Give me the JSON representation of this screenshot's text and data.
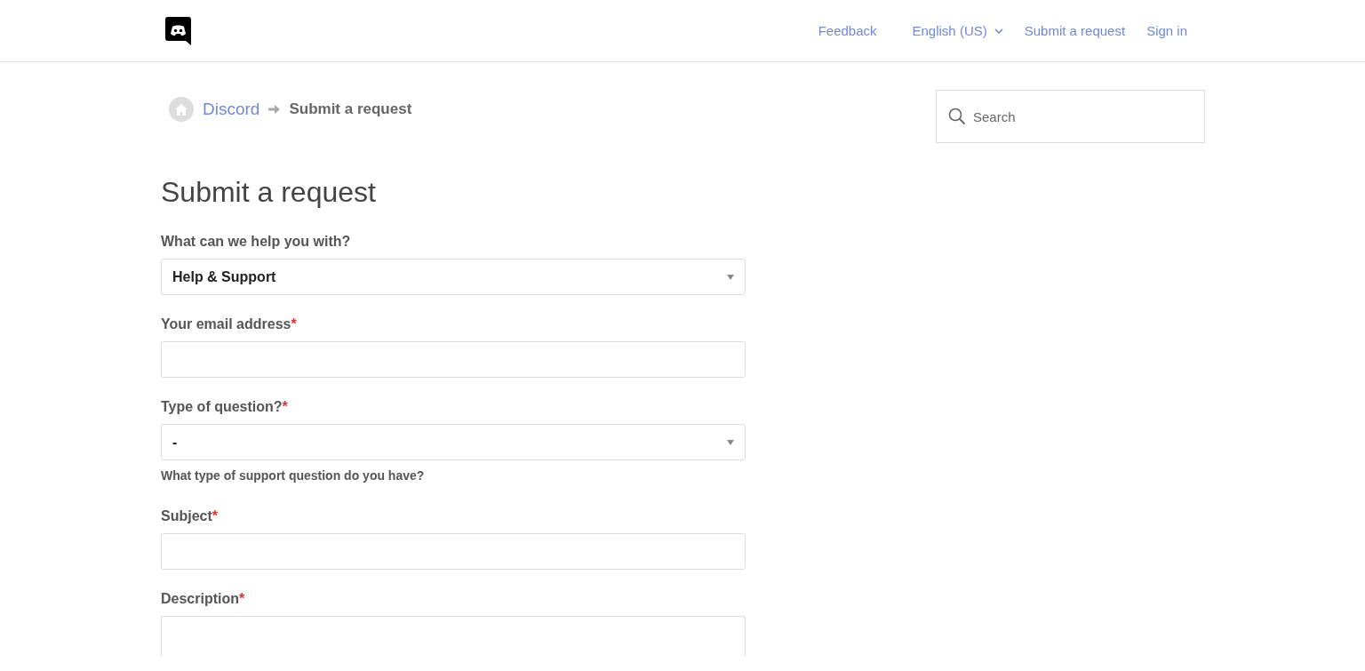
{
  "header": {
    "nav": [
      {
        "kind": "link",
        "label": "Feedback"
      },
      {
        "kind": "dropdown",
        "label": "English (US)"
      },
      {
        "kind": "link",
        "label": "Submit a request"
      },
      {
        "kind": "link",
        "label": "Sign in"
      }
    ]
  },
  "breadcrumb": {
    "items": [
      "Discord"
    ],
    "current": "Submit a request"
  },
  "search": {
    "placeholder": "Search"
  },
  "title": "Submit a request",
  "fields": [
    {
      "kind": "select",
      "label": "What can we help you with?",
      "value": "Help & Support"
    },
    {
      "kind": "input",
      "label": "Your email address",
      "required_mark": "*"
    },
    {
      "kind": "select",
      "label": "Type of question?",
      "required_mark": "*",
      "value": "-",
      "hint": "What type of support question do you have?"
    },
    {
      "kind": "input",
      "label": "Subject",
      "required_mark": "*"
    },
    {
      "kind": "textarea",
      "label": "Description",
      "required_mark": "*"
    }
  ]
}
